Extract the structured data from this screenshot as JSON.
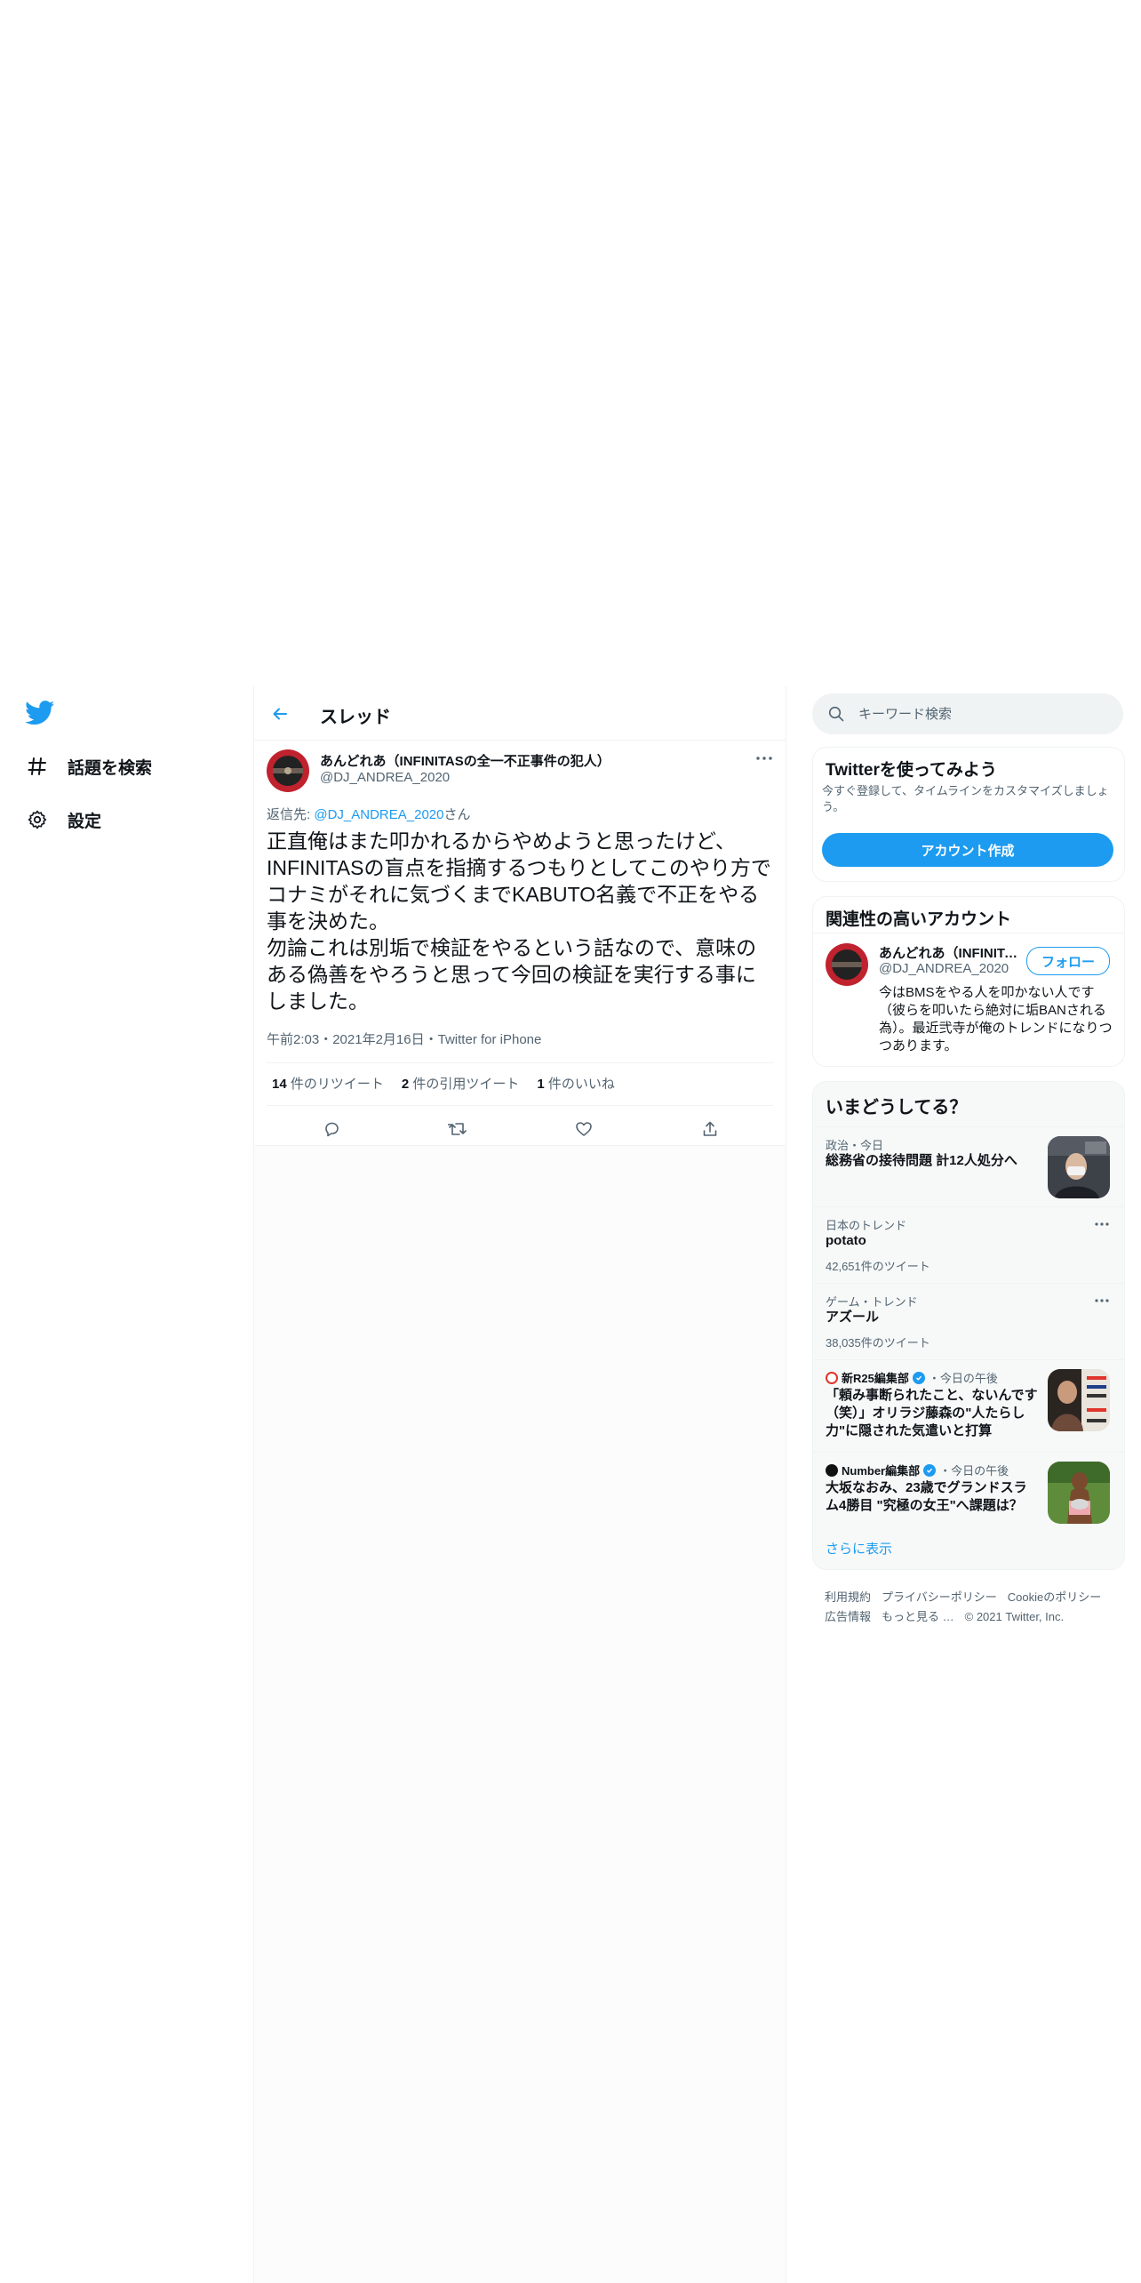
{
  "nav": {
    "items": [
      {
        "label": "話題を検索",
        "icon": "hashtag-icon"
      },
      {
        "label": "設定",
        "icon": "gear-icon"
      }
    ]
  },
  "header": {
    "title": "スレッド"
  },
  "tweet": {
    "author_name": "あんどれあ（INFINITASの全一不正事件の犯人）",
    "author_handle": "@DJ_ANDREA_2020",
    "reply_prefix": "返信先: ",
    "reply_handle": "@DJ_ANDREA_2020",
    "reply_suffix": "さん",
    "text": "正直俺はまた叩かれるからやめようと思ったけど、INFINITASの盲点を指摘するつもりとしてこのやり方でコナミがそれに気づくまでKABUTO名義で不正をやる事を決めた。\n勿論これは別垢で検証をやるという話なので、意味のある偽善をやろうと思って今回の検証を実行する事にしました。",
    "time": "午前2:03",
    "date": "2021年2月16日",
    "source": "Twitter for iPhone",
    "sep": "・",
    "stats": [
      {
        "count": "14",
        "label": "件のリツイート"
      },
      {
        "count": "2",
        "label": "件の引用ツイート"
      },
      {
        "count": "1",
        "label": "件のいいね"
      }
    ]
  },
  "search": {
    "placeholder": "キーワード検索"
  },
  "signup": {
    "title": "Twitterを使ってみよう",
    "desc": "今すぐ登録して、タイムラインをカスタマイズしましょう。",
    "button": "アカウント作成"
  },
  "related": {
    "title": "関連性の高いアカウント",
    "name": "あんどれあ（INFINITASの全一不正事件の犯人）",
    "handle": "@DJ_ANDREA_2020",
    "follow": "フォロー",
    "bio": "今はBMSをやる人を叩かない人です（彼らを叩いたら絶対に垢BANされる為）。最近弐寺が俺のトレンドになりつつあります。"
  },
  "trends": {
    "title": "いまどうしてる？",
    "items": [
      {
        "meta": "政治・今日",
        "title": "総務省の接待問題 計12人処分へ"
      },
      {
        "meta": "日本のトレンド",
        "title": "potato",
        "count": "42,651件のツイート"
      },
      {
        "meta": "ゲーム・トレンド",
        "title": "アズール",
        "count": "38,035件のツイート"
      },
      {
        "publisher": "新R25編集部",
        "time": "・今日の午後",
        "title": "「頼み事断られたこと、ないんです（笑）」オリラジ藤森の\"人たらし力\"に隠された気遣いと打算"
      },
      {
        "publisher": "Number編集部",
        "time": "・今日の午後",
        "title": "大坂なおみ、23歳でグランドスラム4勝目 \"究極の女王\"へ課題は？"
      }
    ],
    "show_more": "さらに表示"
  },
  "footer": {
    "terms": "利用規約",
    "privacy": "プライバシーポリシー",
    "cookies": "Cookieのポリシー",
    "ads": "広告情報",
    "more": "もっと見る …",
    "copyright": "© 2021 Twitter, Inc."
  },
  "colors": {
    "accent": "#1d9bf0",
    "text": "#0f1419",
    "secondary": "#536471"
  }
}
